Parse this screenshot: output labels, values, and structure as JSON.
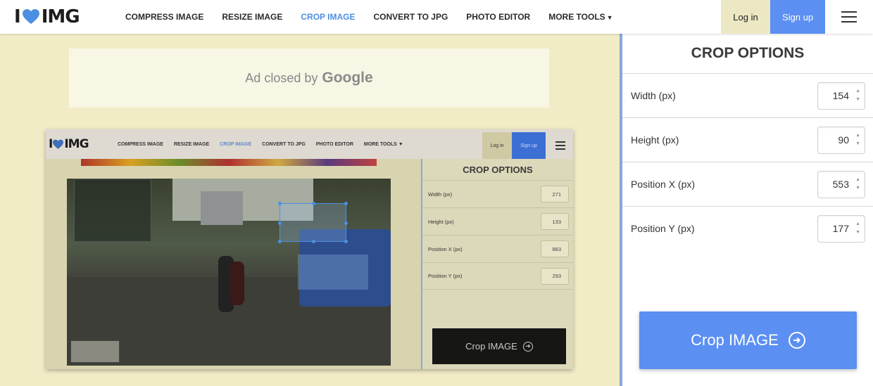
{
  "app": {
    "logo_left": "I",
    "logo_right": "IMG"
  },
  "nav": {
    "items": [
      {
        "label": "COMPRESS IMAGE"
      },
      {
        "label": "RESIZE IMAGE"
      },
      {
        "label": "CROP IMAGE",
        "active": true
      },
      {
        "label": "CONVERT TO JPG"
      },
      {
        "label": "PHOTO EDITOR"
      },
      {
        "label": "MORE TOOLS"
      }
    ],
    "login": "Log in",
    "signup": "Sign up"
  },
  "ad": {
    "text": "Ad closed by",
    "brand": "Google"
  },
  "embed": {
    "nav": [
      "COMPRESS IMAGE",
      "RESIZE IMAGE",
      "CROP IMAGE",
      "CONVERT TO JPG",
      "PHOTO EDITOR",
      "MORE TOOLS"
    ],
    "login": "Log in",
    "signup": "Sign up",
    "panel_title": "CROP OPTIONS",
    "fields": [
      {
        "label": "Width (px)",
        "value": "271"
      },
      {
        "label": "Height (px)",
        "value": "133"
      },
      {
        "label": "Position X (px)",
        "value": "883"
      },
      {
        "label": "Position Y (px)",
        "value": "293"
      }
    ],
    "crop_button": "Crop IMAGE"
  },
  "panel": {
    "title": "CROP OPTIONS",
    "fields": [
      {
        "label": "Width (px)",
        "value": "154"
      },
      {
        "label": "Height (px)",
        "value": "90"
      },
      {
        "label": "Position X (px)",
        "value": "553"
      },
      {
        "label": "Position Y (px)",
        "value": "177"
      }
    ],
    "crop_button": "Crop IMAGE"
  },
  "colors": {
    "accent": "#5b8ff2",
    "page_bg": "#f2ecc6",
    "heart": "#4d8fe0"
  }
}
